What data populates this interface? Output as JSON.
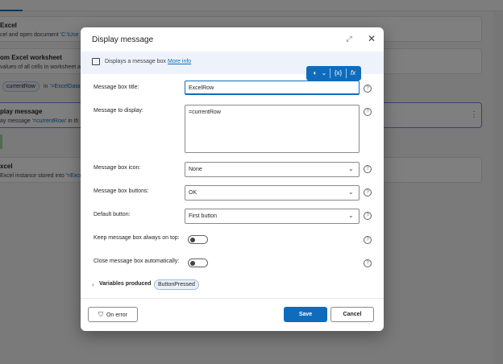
{
  "background": {
    "cards": [
      {
        "title": "Excel",
        "subtitle_prefix": "cel and open document ",
        "subtitle_token": "'C:\\Use"
      },
      {
        "title": "om Excel worksheet",
        "subtitle_prefix": "values of all cells in worksheet a",
        "subtitle_token": ""
      },
      {
        "title": "play message",
        "subtitle_prefix": "ay message ",
        "subtitle_token": "'=currentRow'",
        "subtitle_suffix": " in th"
      },
      {
        "title": "xcel",
        "subtitle_prefix": "Excel instance stored into ",
        "subtitle_token": "'=Excel"
      }
    ],
    "loop_row": {
      "pill": "currentRow",
      "in_text": "in",
      "token": "'=ExcelData"
    },
    "more_icon": "⋮"
  },
  "dialog": {
    "title": "Display message",
    "expand_icon": "⤢",
    "close_icon": "✕",
    "info_text": "Displays a message box",
    "info_link": "More info",
    "toolbar": {
      "icon_text": "◐",
      "chevron": "⌄",
      "variable": "{x}",
      "fx": "fx"
    },
    "fields": {
      "title_label": "Message box title:",
      "title_value": "ExcelRow",
      "message_label": "Message to display:",
      "message_value": "=currentRow",
      "icon_label": "Message box icon:",
      "icon_value": "None",
      "buttons_label": "Message box buttons:",
      "buttons_value": "OK",
      "default_label": "Default button:",
      "default_value": "First button",
      "ontop_label": "Keep message box always on top:",
      "autoclose_label": "Close message box automatically:"
    },
    "help": "?",
    "chev_down": "⌄",
    "variables_label": "Variables produced",
    "variables_chevron": "›",
    "variable_pill": "ButtonPressed",
    "buttons": {
      "on_error": "On error",
      "save": "Save",
      "cancel": "Cancel"
    }
  },
  "colors": {
    "accent": "#0f6cbd",
    "info_bar": "#eef3fb"
  }
}
